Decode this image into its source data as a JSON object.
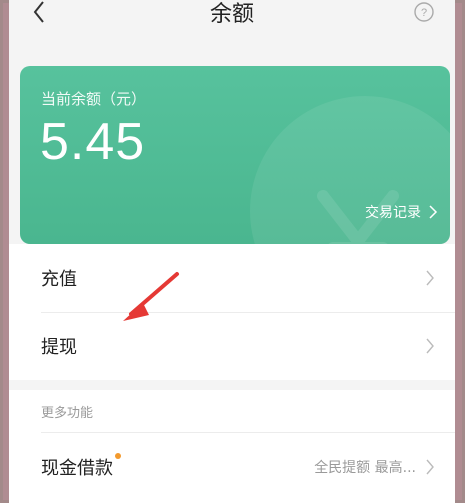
{
  "header": {
    "title": "余额",
    "back_icon": "back-chevron-icon",
    "help_icon": "question-circle-icon"
  },
  "balance_card": {
    "label": "当前余额（元）",
    "amount": "5.45",
    "records_link": "交易记录",
    "accent_color": "#4fbb94"
  },
  "actions": [
    {
      "label": "充值"
    },
    {
      "label": "提现"
    }
  ],
  "more": {
    "title": "更多功能",
    "loan": {
      "label": "现金借款",
      "subtitle": "全民提额 最高...",
      "badge_color": "#f39a2d"
    }
  },
  "annotation": {
    "arrow_color": "#e53935"
  }
}
